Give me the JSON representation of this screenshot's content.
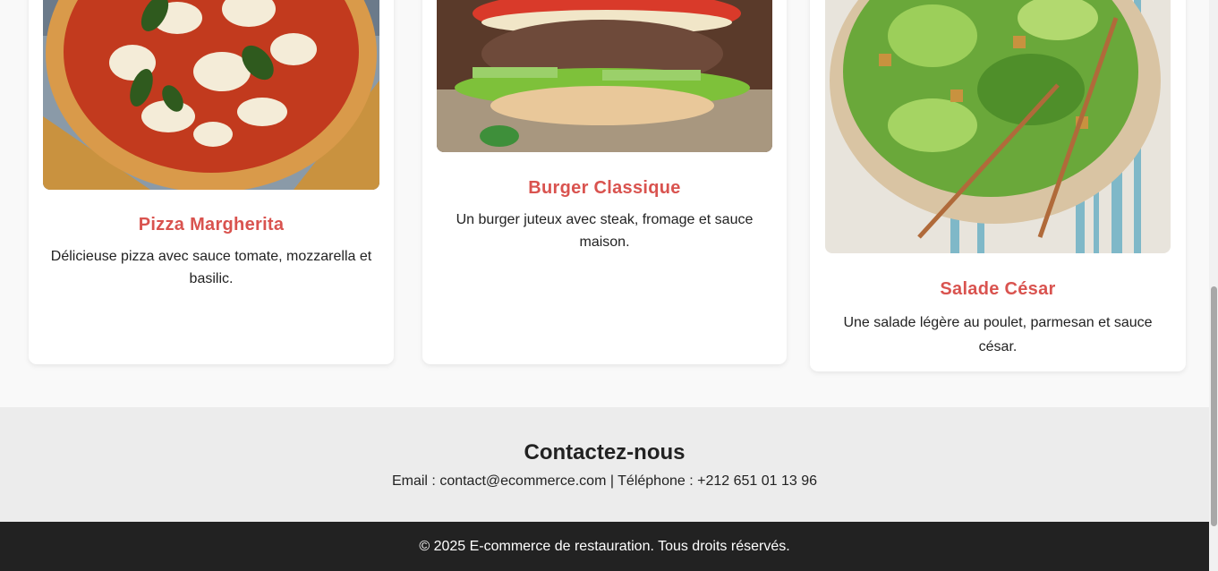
{
  "menu": {
    "items": [
      {
        "name": "Pizza Margherita",
        "description": "Délicieuse pizza avec sauce tomate, mozzarella et basilic."
      },
      {
        "name": "Burger Classique",
        "description": "Un burger juteux avec steak, fromage et sauce maison."
      },
      {
        "name": "Salade César",
        "description": "Une salade légère au poulet, parmesan et sauce césar."
      }
    ]
  },
  "contact": {
    "title": "Contactez-nous",
    "line": "Email : contact@ecommerce.com | Téléphone : +212 651 01 13 96"
  },
  "footer": {
    "copyright": "© 2025 E-commerce de restauration. Tous droits réservés."
  },
  "colors": {
    "accent": "#d9534f",
    "footer_bg": "#222222",
    "contact_bg": "#ececec"
  }
}
